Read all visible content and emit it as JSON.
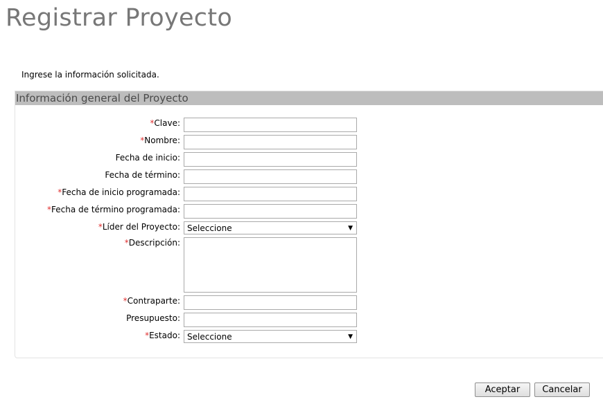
{
  "page": {
    "title": "Registrar Proyecto",
    "instructions": "Ingrese la información solicitada."
  },
  "panel": {
    "header": "Información general del Proyecto"
  },
  "form": {
    "required_marker": "*",
    "clave": {
      "label": "Clave:",
      "value": ""
    },
    "nombre": {
      "label": "Nombre:",
      "value": ""
    },
    "fecha_inicio": {
      "label": "Fecha de inicio:",
      "value": ""
    },
    "fecha_termino": {
      "label": "Fecha de término:",
      "value": ""
    },
    "fecha_inicio_programada": {
      "label": "Fecha de inicio programada:",
      "value": ""
    },
    "fecha_termino_programada": {
      "label": "Fecha de término programada:",
      "value": ""
    },
    "lider": {
      "label": "Líder del Proyecto:",
      "selected": "Seleccione"
    },
    "descripcion": {
      "label": "Descripción:",
      "value": ""
    },
    "contraparte": {
      "label": "Contraparte:",
      "value": ""
    },
    "presupuesto": {
      "label": "Presupuesto:",
      "value": ""
    },
    "estado": {
      "label": "Estado:",
      "selected": "Seleccione"
    },
    "dropdown_arrow": "▼"
  },
  "buttons": {
    "accept": "Aceptar",
    "cancel": "Cancelar"
  }
}
